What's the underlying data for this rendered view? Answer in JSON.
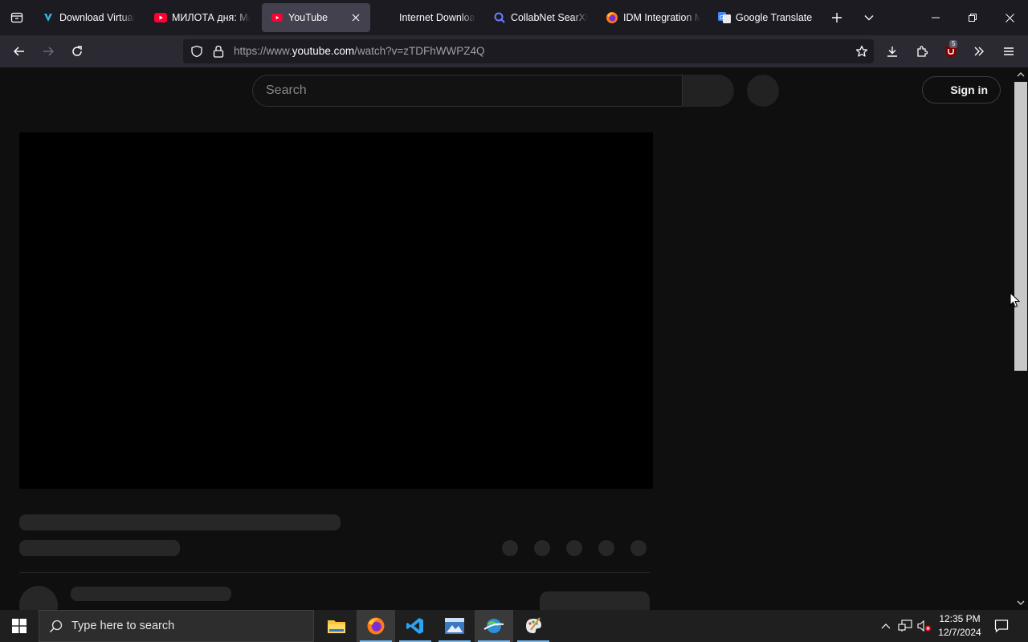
{
  "browser": {
    "tabs": [
      {
        "title": "Download Virtual",
        "icon": "virtualbox-download-icon"
      },
      {
        "title": "МИЛОТА дня: Ма",
        "icon": "youtube-icon"
      },
      {
        "title": "YouTube",
        "icon": "youtube-icon",
        "active": true
      },
      {
        "title": "Internet Downloa",
        "icon": "none"
      },
      {
        "title": "CollabNet SearXN",
        "icon": "search-icon"
      },
      {
        "title": "IDM Integration M",
        "icon": "firefox-icon"
      },
      {
        "title": "Google Translate",
        "icon": "google-translate-icon"
      }
    ],
    "url_prefix": "https://www.",
    "url_domain": "youtube.com",
    "url_path": "/watch?v=zTDFhWWPZ4Q",
    "extension_badge": "5"
  },
  "youtube": {
    "search_placeholder": "Search",
    "signin_label": "Sign in"
  },
  "taskbar": {
    "search_placeholder": "Type here to search",
    "time": "12:35 PM",
    "date": "12/7/2024"
  },
  "colors": {
    "page_bg": "#0f0f0f",
    "skeleton": "#272727",
    "youtube_red": "#ff0033"
  }
}
